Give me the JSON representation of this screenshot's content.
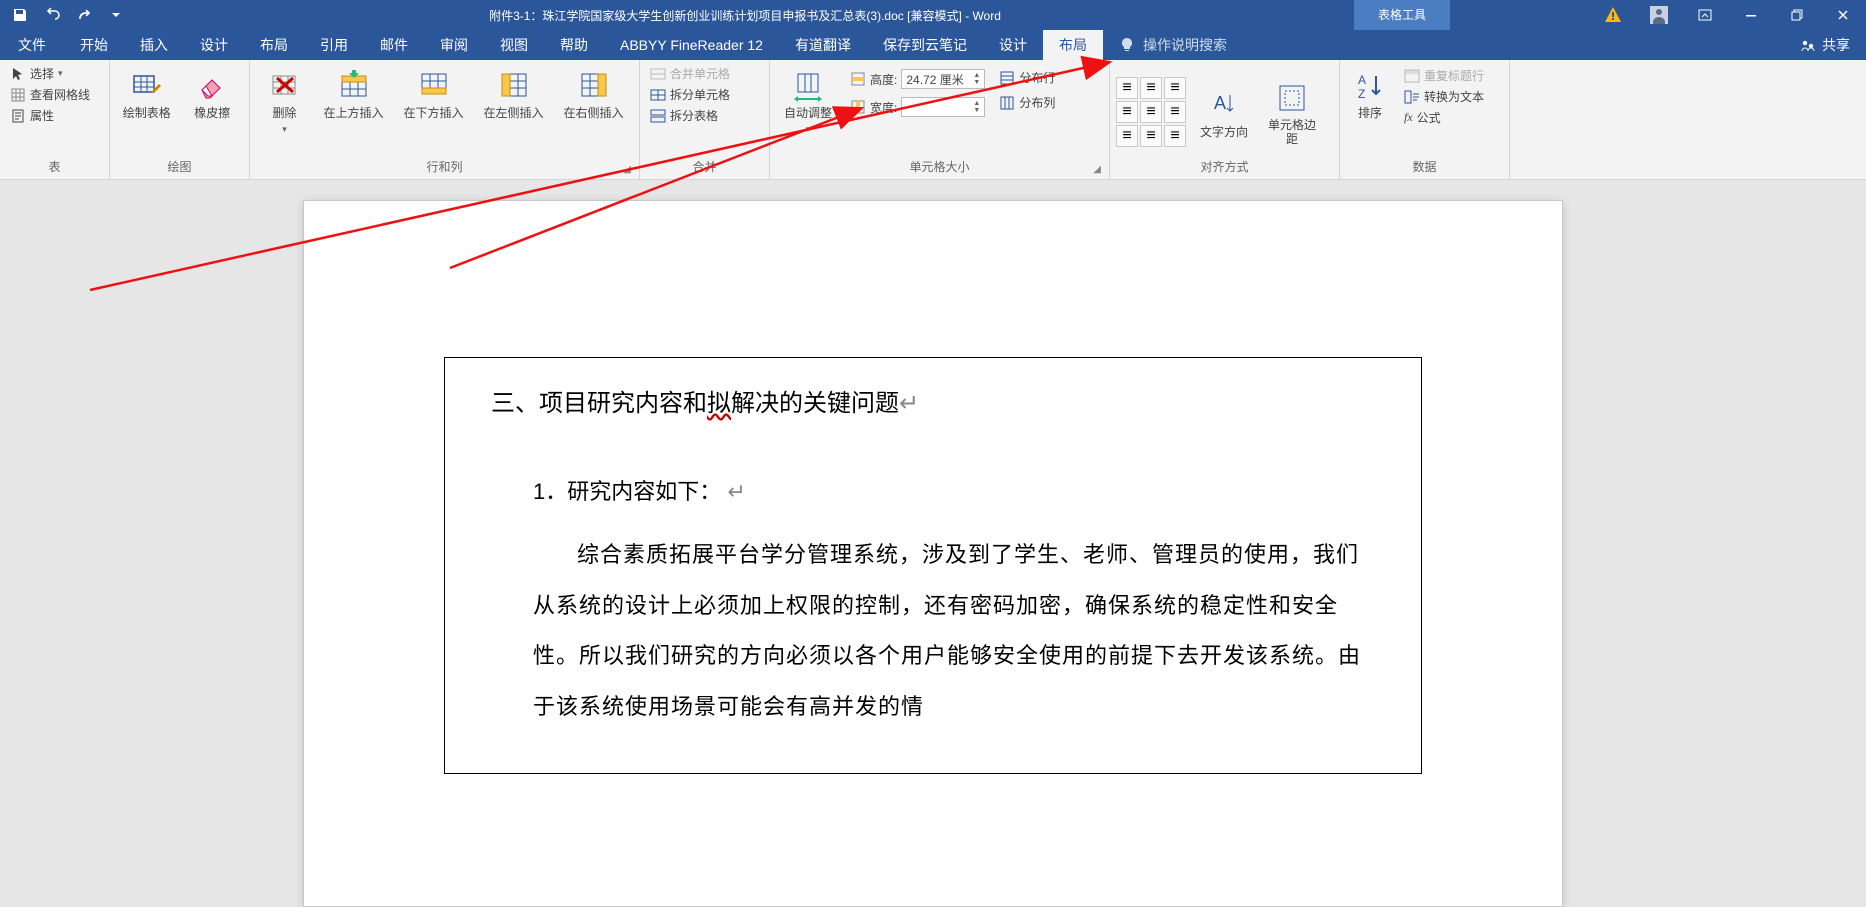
{
  "title": {
    "document": "附件3-1：珠江学院国家级大学生创新创业训练计划项目申报书及汇总表(3).doc [兼容模式]  -  Word",
    "context_tab": "表格工具"
  },
  "tabs": {
    "file": "文件",
    "home": "开始",
    "insert": "插入",
    "design": "设计",
    "layout": "布局",
    "references": "引用",
    "mail": "邮件",
    "review": "审阅",
    "view": "视图",
    "help": "帮助",
    "abbyy": "ABBYY FineReader 12",
    "youdao": "有道翻译",
    "savetocloud": "保存到云笔记",
    "table_design": "设计",
    "table_layout": "布局",
    "tell_me": "操作说明搜索",
    "share": "共享"
  },
  "ribbon": {
    "group_table": {
      "label": "表",
      "select": "选择",
      "gridlines": "查看网格线",
      "properties": "属性"
    },
    "group_draw": {
      "label": "绘图",
      "draw_table": "绘制表格",
      "eraser": "橡皮擦"
    },
    "group_rc": {
      "label": "行和列",
      "delete": "删除",
      "insert_above": "在上方插入",
      "insert_below": "在下方插入",
      "insert_left": "在左侧插入",
      "insert_right": "在右侧插入"
    },
    "group_merge": {
      "label": "合并",
      "merge": "合并单元格",
      "split_cells": "拆分单元格",
      "split_table": "拆分表格"
    },
    "group_cellsize": {
      "label": "单元格大小",
      "autofit": "自动调整",
      "height_label": "高度:",
      "height_value": "24.72 厘米",
      "width_label": "宽度:",
      "width_value": "",
      "dist_rows": "分布行",
      "dist_cols": "分布列"
    },
    "group_align": {
      "label": "对齐方式",
      "text_dir": "文字方向",
      "cell_margin": "单元格边距"
    },
    "group_data": {
      "label": "数据",
      "sort": "排序",
      "repeat_header": "重复标题行",
      "convert": "转换为文本",
      "formula": "公式"
    }
  },
  "document": {
    "heading_prefix": "三、项目研究内容和",
    "heading_underlined": "拟",
    "heading_suffix": "解决的关键问题",
    "subheading": "1．研究内容如下：",
    "paragraph": "综合素质拓展平台学分管理系统，涉及到了学生、老师、管理员的使用，我们从系统的设计上必须加上权限的控制，还有密码加密，确保系统的稳定性和安全性。所以我们研究的方向必须以各个用户能够安全使用的前提下去开发该系统。由于该系统使用场景可能会有高并发的情"
  }
}
